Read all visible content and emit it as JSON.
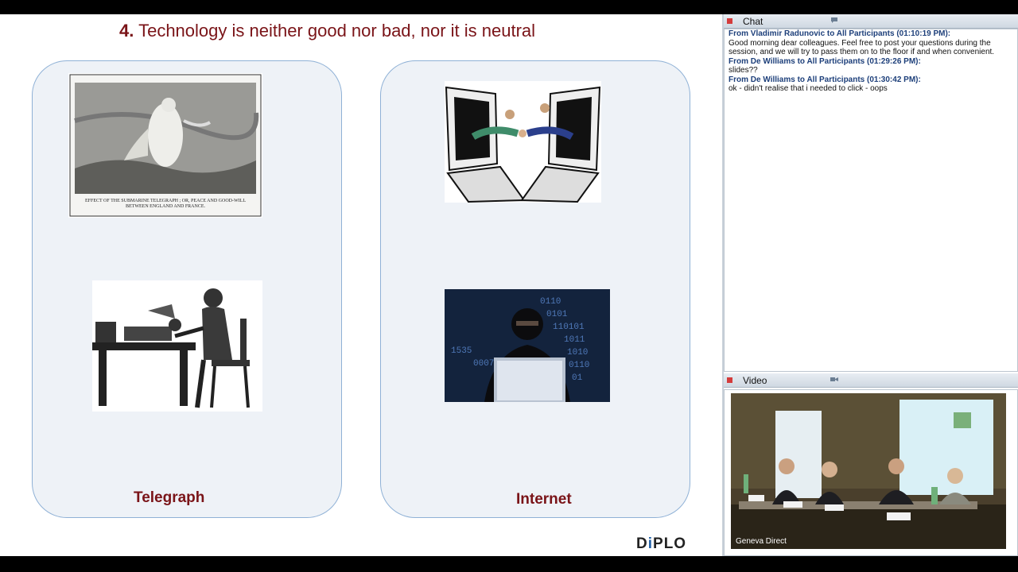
{
  "slide": {
    "title_number": "4.",
    "title_text": "Technology is neither good nor bad, nor it is neutral",
    "left_caption": "Telegraph",
    "right_caption": "Internet",
    "engraving_caption_1": "EFFECT OF THE SUBMARINE TELEGRAPH ; OR, PEACE AND GOOD-WILL",
    "engraving_caption_2": "BETWEEN ENGLAND AND FRANCE.",
    "logo_d": "D",
    "logo_i": "i",
    "logo_rest": "PLO"
  },
  "chat": {
    "title": "Chat",
    "messages": [
      {
        "from": "From Vladimir Radunovic to All Participants (01:10:19 PM):",
        "text": "Good morning dear colleagues. Feel free to post your questions during the session, and we will try to pass them on to the floor if and when convenient."
      },
      {
        "from": "From De Williams to All Participants (01:29:26 PM):",
        "text": "slides??"
      },
      {
        "from": "From De Williams to All Participants (01:30:42 PM):",
        "text": "ok - didn't realise that i needed to click - oops"
      }
    ]
  },
  "video": {
    "title": "Video",
    "overlay_label": "Geneva Direct"
  },
  "colors": {
    "title": "#7a1418",
    "panel_border": "#8fb1d6",
    "chat_from": "#1d3f7a"
  }
}
